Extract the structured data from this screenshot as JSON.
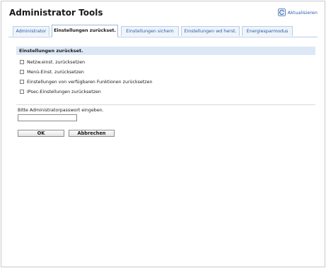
{
  "header": {
    "title": "Administrator Tools",
    "refresh_label": "Aktualisieren",
    "refresh_icon": "refresh-icon"
  },
  "tabs": [
    {
      "label": "Administrator",
      "active": false
    },
    {
      "label": "Einstellungen zurückset.",
      "active": true
    },
    {
      "label": "Einstellungen sichern",
      "active": false
    },
    {
      "label": "Einstellungen wd herst.",
      "active": false
    },
    {
      "label": "Energiesparmodus",
      "active": false
    }
  ],
  "section": {
    "title": "Einstellungen zurückset.",
    "options": [
      {
        "label": "Netzw.einst. zurücksetzen",
        "checked": false
      },
      {
        "label": "Menü-Einst. zurücksetzen",
        "checked": false
      },
      {
        "label": "Einstellungen von verfügbaren Funktionen zurücksetzen",
        "checked": false
      },
      {
        "label": "IPsec-Einstellungen zurücksetzen",
        "checked": false
      }
    ]
  },
  "password": {
    "label": "Bitte Administratorpasswort eingeben.",
    "value": "",
    "placeholder": ""
  },
  "buttons": {
    "ok": "OK",
    "cancel": "Abbrechen"
  },
  "colors": {
    "link": "#2e5aa3",
    "section_bg": "#dce8f6",
    "tab_border": "#b9cde6"
  }
}
